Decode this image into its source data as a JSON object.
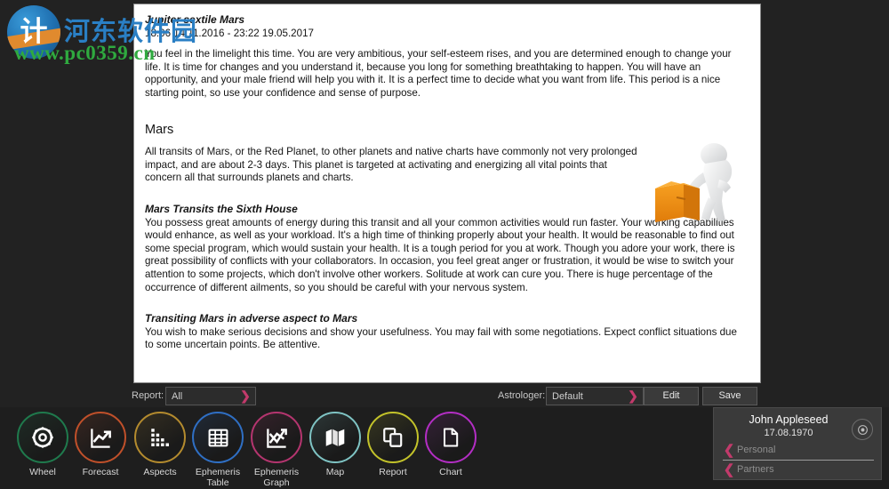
{
  "watermark": {
    "logo_glyph": "计",
    "site_name_cn": "河东软件园",
    "url": "www.pc0359.cn"
  },
  "document": {
    "transit_title": "Jupiter sextile Mars",
    "transit_dates": "18:06 14.11.2016 - 23:22 19.05.2017",
    "intro_paragraph": "You feel in the limelight this time. You are very ambitious, your self-esteem rises, and you are determined enough to change your life. It is time for changes and you understand it, because you long for something breathtaking to happen. You will have an opportunity, and your male friend will help you with it. It is a perfect time to decide what you want from life. This period is a nice starting point, so use your confidence and sense of purpose.",
    "planet_heading": "Mars",
    "planet_paragraph": "All transits of Mars, or the Red Planet, to other planets and native charts have commonly not very prolonged impact, and are about 2-3 days. This planet is targeted at activating and energizing all vital points that concern all that surrounds planets and charts.",
    "house_heading": "Mars Transits the Sixth House",
    "house_paragraph": "You possess great amounts of energy during this transit and all your common activities would run faster. Your working capabilities would enhance, as well as your workload. It's a high time of thinking properly about your health. It would be reasonable to find out some special program, which would sustain your health. It is a tough period for you at work. Though you adore your work, there is great possibility of conflicts with your collaborators. In occasion, you feel great anger or frustration, it would be wise to switch your attention to some projects, which don't involve other workers. Solitude at work can cure you. There is huge percentage of the occurrence of different ailments, so you should be careful with your nervous system.",
    "aspect_heading": "Transiting Mars in adverse aspect to Mars",
    "aspect_paragraph": "You wish to make serious decisions and show your usefulness. You may fail with some negotiations. Expect conflict situations due to some uncertain points. Be attentive.",
    "illustration_name": "figure-pushing-box-illustration"
  },
  "optionbar": {
    "report_label": "Report:",
    "report_value": "All",
    "astrologer_label": "Astrologer:",
    "astrologer_value": "Default",
    "edit_label": "Edit",
    "save_label": "Save",
    "arrow_glyph": "❯"
  },
  "toolbar": {
    "items": [
      {
        "label": "Wheel",
        "icon": "wheel-gear-icon",
        "color": "#1f7a4d"
      },
      {
        "label": "Forecast",
        "icon": "trend-up-chart-icon",
        "color": "#c0502a"
      },
      {
        "label": "Aspects",
        "icon": "dot-matrix-icon",
        "color": "#b48b2e"
      },
      {
        "label": "Ephemeris\nTable",
        "icon": "grid-table-icon",
        "color": "#2f6fc4"
      },
      {
        "label": "Ephemeris\nGraph",
        "icon": "crossing-lines-icon",
        "color": "#b5356f"
      },
      {
        "label": "Map",
        "icon": "folded-map-icon",
        "color": "#7fc4c4"
      },
      {
        "label": "Report",
        "icon": "stacked-pages-icon",
        "color": "#c3c32a"
      },
      {
        "label": "Chart",
        "icon": "document-page-icon",
        "color": "#b32ec4"
      }
    ]
  },
  "profile": {
    "name": "John Appleseed",
    "birth_date": "17.08.1970",
    "settings_icon": "gear-icon",
    "rows": [
      {
        "label": "Personal",
        "chevron": "❮"
      },
      {
        "label": "Partners",
        "chevron": "❮"
      }
    ]
  }
}
